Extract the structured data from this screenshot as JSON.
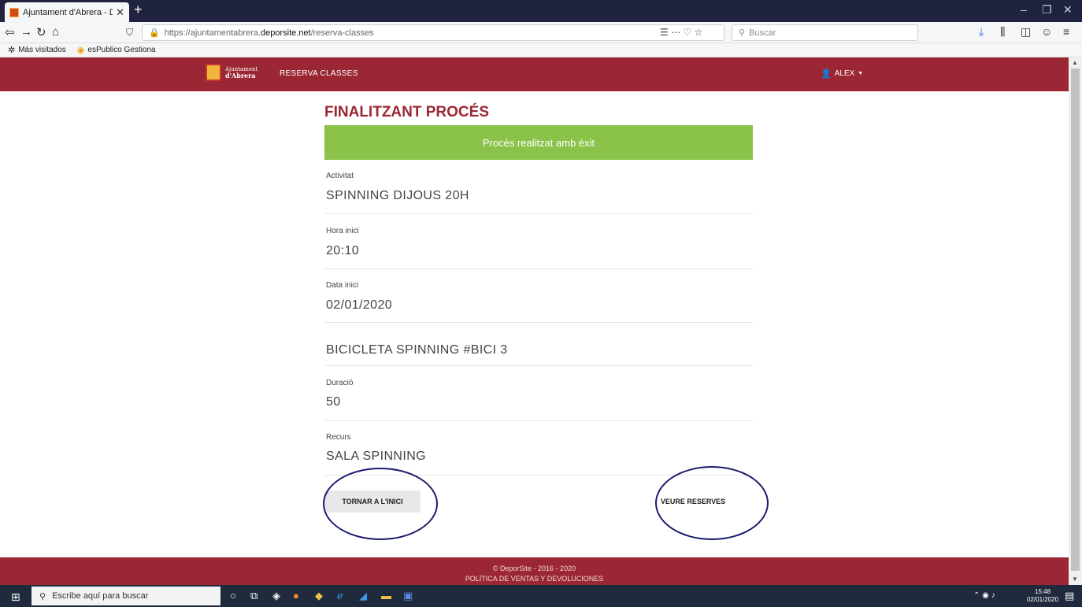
{
  "browser": {
    "tab_title": "Ajuntament d'Abrera - DeporSi",
    "tab_close": "✕",
    "new_tab": "+",
    "url_scheme": "https://ajuntamentabrera.",
    "url_host": "deporsite.net",
    "url_path": "/reserva-classes",
    "search_placeholder": "Buscar",
    "bookmarks": [
      "Más visitados",
      "esPublico Gestiona"
    ]
  },
  "header": {
    "logo_line1": "Ajuntament",
    "logo_line2": "d'Abrera",
    "nav_item": "RESERVA CLASSES",
    "user": "ALEX"
  },
  "main": {
    "title": "FINALITZANT PROCÉS",
    "success_message": "Procés realitzat amb èxit",
    "fields": [
      {
        "label": "Activitat",
        "value": "SPINNING DIJOUS 20H"
      },
      {
        "label": "Hora inici",
        "value": "20:10"
      },
      {
        "label": "Data inici",
        "value": "02/01/2020"
      },
      {
        "label": "",
        "value": "BICICLETA SPINNING #BICI 3"
      },
      {
        "label": "Duració",
        "value": "50"
      },
      {
        "label": "Recurs",
        "value": "SALA SPINNING"
      }
    ],
    "buttons": {
      "home": "TORNAR A L'INICI",
      "reservations": "VEURE RESERVES"
    }
  },
  "footer": {
    "copyright": "© DeporSite - 2016 - 2020",
    "policy_link": "POLÍTICA DE VENTAS Y DEVOLUCIONES"
  },
  "taskbar": {
    "search_placeholder": "Escribe aquí para buscar",
    "time": "15:48",
    "date": "02/01/2020"
  },
  "colors": {
    "brand": "#9a2733",
    "success": "#8bc34a",
    "annotation": "#1a1a6e"
  }
}
